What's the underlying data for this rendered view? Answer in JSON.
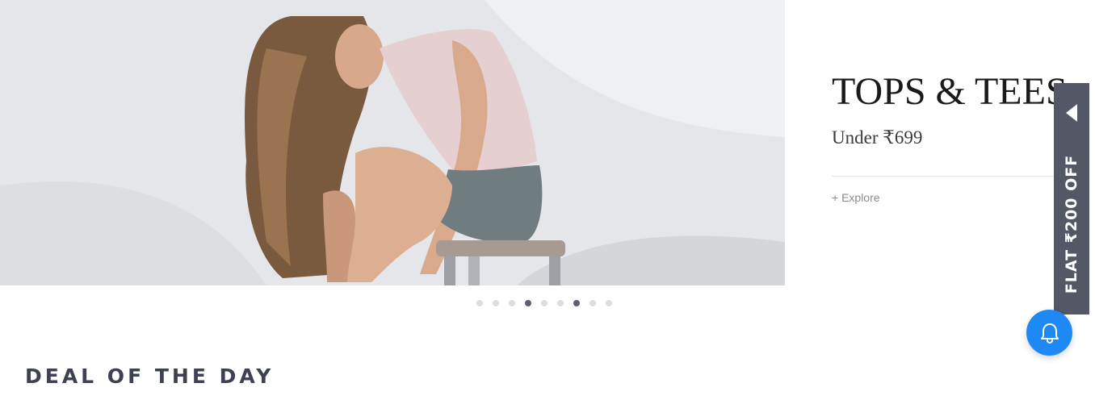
{
  "banner": {
    "image_alt": "Model in knit tank top sitting on a stool",
    "title": "TOPS & TEES",
    "subtitle": "Under ₹699",
    "explore_label": "+ Explore"
  },
  "carousel": {
    "total_slides": 9,
    "active_indices": [
      3,
      6
    ]
  },
  "offer_tab": {
    "label": "FLAT ₹200 OFF",
    "icon": "caret-left-icon",
    "background": "#535766"
  },
  "notification_button": {
    "icon": "bell-icon",
    "color": "#1e88f5"
  },
  "section": {
    "title": "DEAL OF THE DAY"
  }
}
